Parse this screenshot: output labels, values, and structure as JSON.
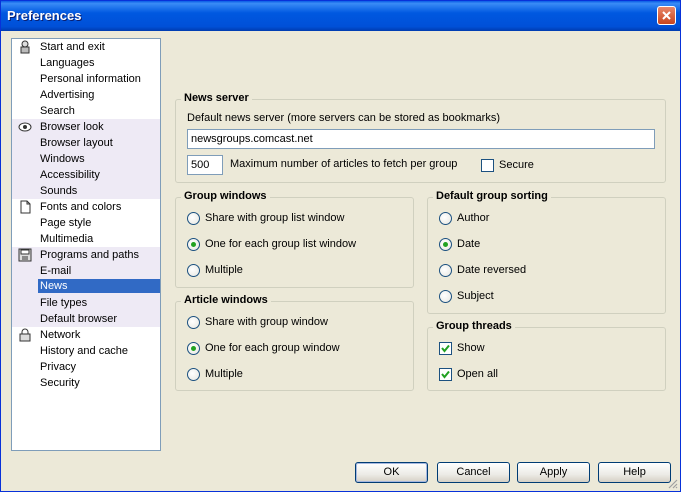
{
  "window": {
    "title": "Preferences"
  },
  "tree": {
    "items": [
      {
        "label": "Start and exit",
        "icon": "person-icon"
      },
      {
        "label": "Languages"
      },
      {
        "label": "Personal information"
      },
      {
        "label": "Advertising"
      },
      {
        "label": "Search"
      },
      {
        "label": "Browser look",
        "icon": "eye-icon"
      },
      {
        "label": "Browser layout"
      },
      {
        "label": "Windows"
      },
      {
        "label": "Accessibility"
      },
      {
        "label": "Sounds"
      },
      {
        "label": "Fonts and colors",
        "icon": "document-icon"
      },
      {
        "label": "Page style"
      },
      {
        "label": "Multimedia"
      },
      {
        "label": "Programs and paths",
        "icon": "disk-icon"
      },
      {
        "label": "E-mail"
      },
      {
        "label": "News",
        "selected": true
      },
      {
        "label": "File types"
      },
      {
        "label": "Default browser"
      },
      {
        "label": "Network",
        "icon": "lock-icon"
      },
      {
        "label": "History and cache"
      },
      {
        "label": "Privacy"
      },
      {
        "label": "Security"
      }
    ]
  },
  "news_server": {
    "legend": "News server",
    "description": "Default news server (more servers can be stored as bookmarks)",
    "server_value": "newsgroups.comcast.net",
    "max_articles_value": "500",
    "max_articles_label": "Maximum number of articles to fetch per group",
    "secure_label": "Secure",
    "secure_checked": false
  },
  "group_windows": {
    "legend": "Group windows",
    "options": [
      "Share with group list window",
      "One for each group list window",
      "Multiple"
    ],
    "selected": "One for each group list window"
  },
  "default_group_sorting": {
    "legend": "Default group sorting",
    "options": [
      "Author",
      "Date",
      "Date reversed",
      "Subject"
    ],
    "selected": "Date"
  },
  "article_windows": {
    "legend": "Article windows",
    "options": [
      "Share with group window",
      "One for each group window",
      "Multiple"
    ],
    "selected": "One for each group window"
  },
  "group_threads": {
    "legend": "Group threads",
    "show_label": "Show",
    "show_checked": true,
    "open_all_label": "Open all",
    "open_all_checked": true
  },
  "buttons": {
    "ok": "OK",
    "cancel": "Cancel",
    "apply": "Apply",
    "help": "Help"
  }
}
